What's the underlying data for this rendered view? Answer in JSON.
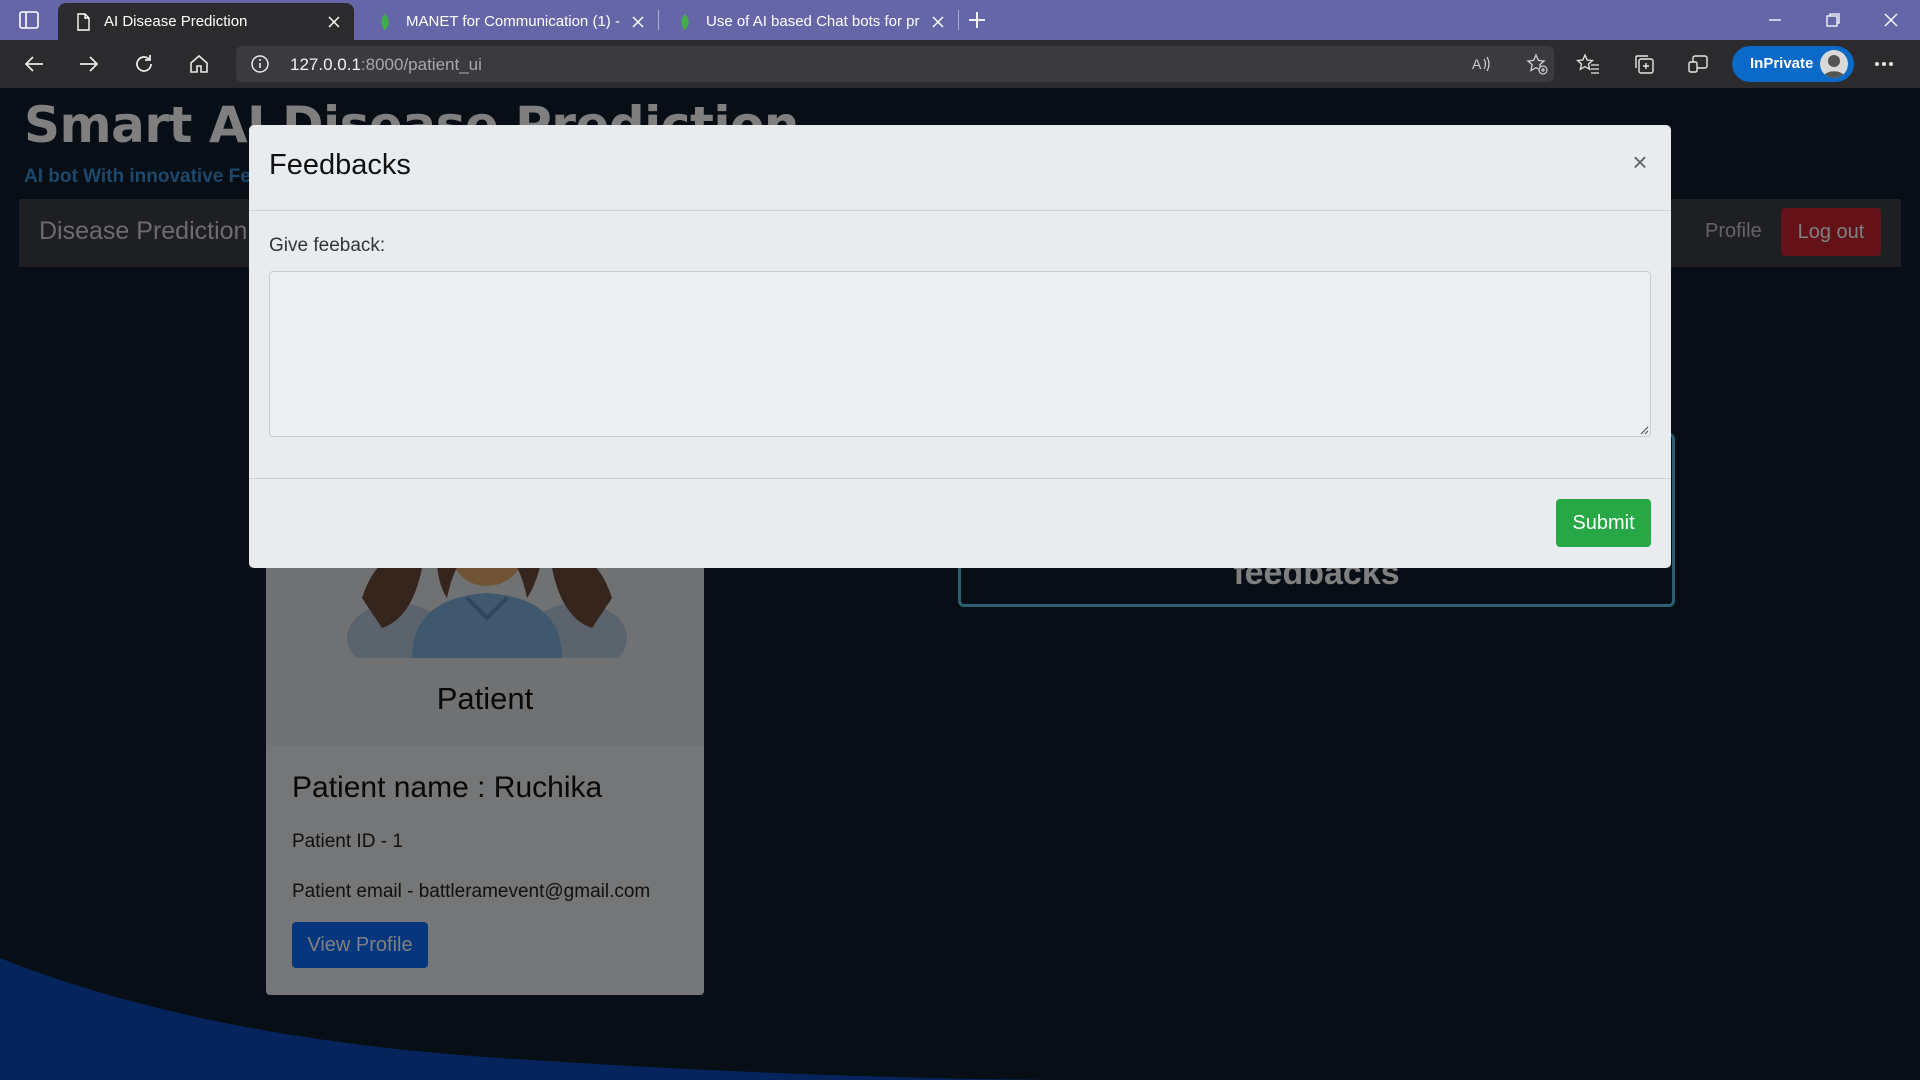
{
  "browser": {
    "tabs": [
      {
        "title": "AI Disease Prediction",
        "active": true
      },
      {
        "title": "MANET for Communication (1) -",
        "active": false
      },
      {
        "title": "Use of AI based Chat bots for pr",
        "active": false
      }
    ],
    "address": {
      "url_host": "127.0.0.1",
      "url_rest": ":8000/patient_ui"
    },
    "inprivate_label": "InPrivate"
  },
  "site": {
    "title": "Smart AI Disease Prediction",
    "subtitle": "AI bot With innovative Features"
  },
  "navbar": {
    "brand": "Disease Prediction",
    "profile_link": "Profile",
    "logout_label": "Log out"
  },
  "patient_card": {
    "role": "Patient",
    "name_line": "Patient name : Ruchika",
    "id_line": "Patient ID - 1",
    "email_line": "Patient email - battleramevent@gmail.com",
    "view_profile_label": "View Profile"
  },
  "feedback_card": {
    "label": "feedbacks"
  },
  "modal": {
    "title": "Feedbacks",
    "close_glyph": "×",
    "prompt": "Give feeback:",
    "textarea_value": "",
    "submit_label": "Submit"
  },
  "colors": {
    "tabbar": "#6466a8",
    "chrome": "#2b2b2e",
    "inprivate": "#0b69c7",
    "logout": "#c8232f",
    "view_profile": "#0d6efd",
    "submit": "#27a745",
    "wave": "#0a49b8"
  },
  "icons": [
    "sidebar-toggle-icon",
    "page-icon",
    "leaf-icon",
    "close-icon",
    "plus-icon",
    "minimize-icon",
    "restore-icon",
    "back-icon",
    "forward-icon",
    "refresh-icon",
    "home-icon",
    "info-icon",
    "read-aloud-icon",
    "add-favorite-icon",
    "favorites-icon",
    "collections-icon",
    "cast-icon",
    "more-icon"
  ]
}
